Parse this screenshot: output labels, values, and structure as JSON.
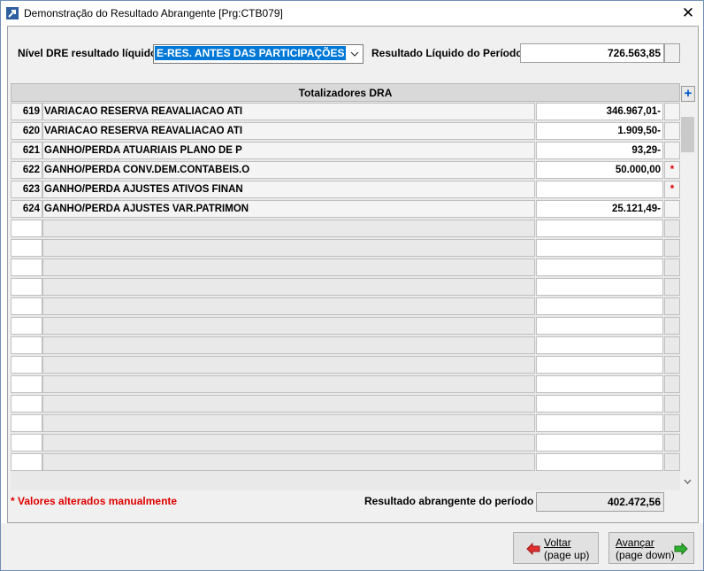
{
  "window": {
    "title": "Demonstração do Resultado Abrangente [Prg:CTB079]",
    "close": "✕"
  },
  "filter": {
    "nivel_label": "Nível DRE resultado líquido",
    "nivel_value": "E-RES. ANTES DAS PARTICIPAÇÕES",
    "resultado_label": "Resultado Líquido do Período",
    "resultado_value": "726.563,85"
  },
  "grid": {
    "header": "Totalizadores DRA",
    "rows": [
      {
        "num": "619",
        "desc": "VARIACAO RESERVA REAVALIACAO ATI",
        "value": "346.967,01-",
        "flag": ""
      },
      {
        "num": "620",
        "desc": "VARIACAO RESERVA REAVALIACAO ATI",
        "value": "1.909,50-",
        "flag": ""
      },
      {
        "num": "621",
        "desc": "GANHO/PERDA ATUARIAIS PLANO DE P",
        "value": "93,29-",
        "flag": ""
      },
      {
        "num": "622",
        "desc": "GANHO/PERDA CONV.DEM.CONTABEIS.O",
        "value": "50.000,00",
        "flag": "*"
      },
      {
        "num": "623",
        "desc": "GANHO/PERDA AJUSTES ATIVOS FINAN",
        "value": "",
        "flag": "*"
      },
      {
        "num": "624",
        "desc": "GANHO/PERDA AJUSTES VAR.PATRIMON",
        "value": "25.121,49-",
        "flag": ""
      }
    ]
  },
  "footer": {
    "note": "* Valores alterados manualmente",
    "total_label": "Resultado abrangente do período",
    "total_value": "402.472,56"
  },
  "buttons": {
    "back_line1": "Voltar",
    "back_line2": "(page up)",
    "next_line1": "Avançar",
    "next_line2": "(page down)"
  },
  "colors": {
    "selection": "#0078d7",
    "flag": "#e00000",
    "arrow_back": "#e03030",
    "arrow_next": "#30b030"
  },
  "icons": {
    "combo": "chevron-down-icon",
    "add": "plus-icon",
    "back": "arrow-left-icon",
    "next": "arrow-right-icon"
  }
}
